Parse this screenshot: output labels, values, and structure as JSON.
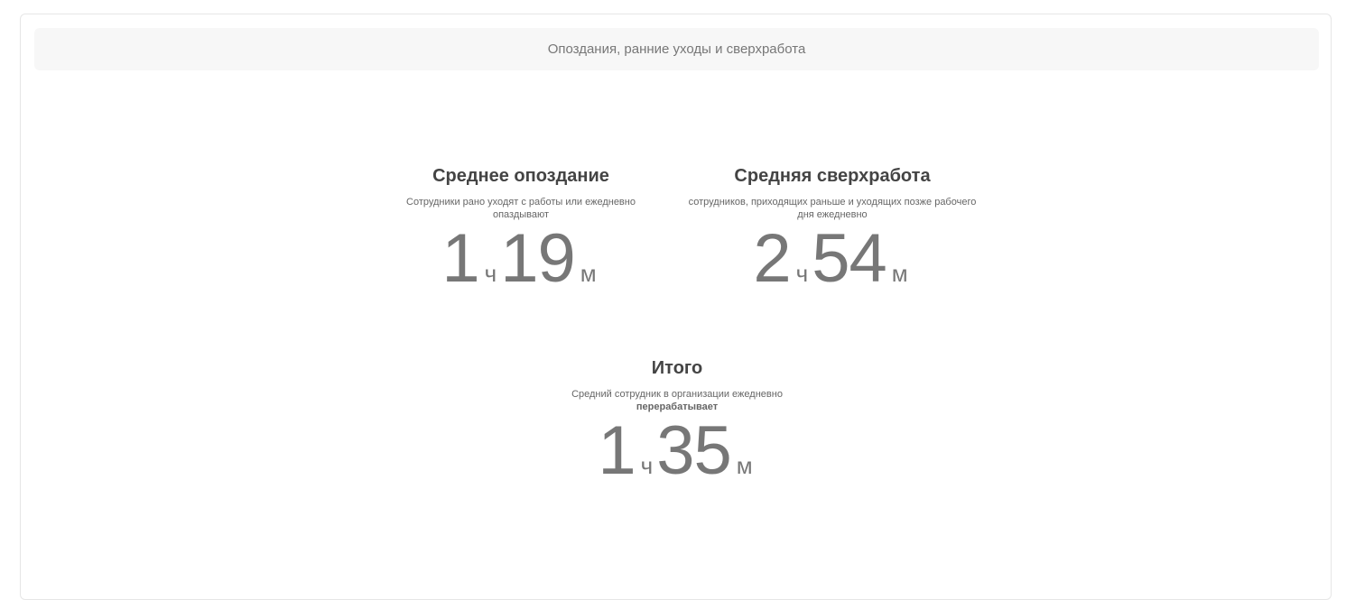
{
  "header": {
    "title": "Опоздания, ранние уходы и сверхработа"
  },
  "stats": {
    "late": {
      "title": "Среднее опоздание",
      "desc": "Сотрудники рано уходят с работы или ежедневно опаздывают",
      "hours": "1",
      "hours_unit": "ч",
      "minutes": "19",
      "minutes_unit": "м"
    },
    "overtime": {
      "title": "Средняя сверхработа",
      "desc": "сотрудников, приходящих раньше и уходящих позже рабочего дня ежедневно",
      "hours": "2",
      "hours_unit": "ч",
      "minutes": "54",
      "minutes_unit": "м"
    },
    "total": {
      "title": "Итого",
      "desc_line1": "Средний сотрудник в организации ежедневно",
      "desc_bold": "перерабатывает",
      "hours": "1",
      "hours_unit": "ч",
      "minutes": "35",
      "minutes_unit": "м"
    }
  }
}
